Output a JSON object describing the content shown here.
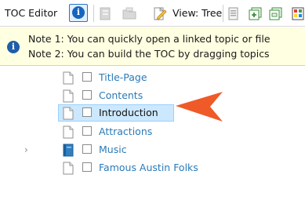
{
  "toolbar": {
    "title": "TOC Editor",
    "view_label": "View: Tree",
    "info_glyph": "i"
  },
  "note": {
    "icon_glyph": "i",
    "line1": "Note 1: You can quickly open a linked topic or file",
    "line2": "Note 2: You can build the TOC by dragging topics"
  },
  "tree": {
    "items": [
      {
        "label": "Title-Page",
        "icon": "page-icon",
        "selected": false,
        "expandable": false
      },
      {
        "label": "Contents",
        "icon": "page-icon",
        "selected": false,
        "expandable": false
      },
      {
        "label": "Introduction",
        "icon": "page-icon",
        "selected": true,
        "expandable": false
      },
      {
        "label": "Attractions",
        "icon": "page-icon",
        "selected": false,
        "expandable": false
      },
      {
        "label": "Music",
        "icon": "book-icon",
        "selected": false,
        "expandable": true
      },
      {
        "label": "Famous Austin Folks",
        "icon": "page-icon",
        "selected": false,
        "expandable": false
      }
    ],
    "expander_glyph": "›"
  },
  "colors": {
    "link": "#2a7ab8",
    "selection": "#cce8ff",
    "note_bg": "#ffffe1",
    "callout_arrow": "#f05a28",
    "info_blue": "#1565c0"
  }
}
